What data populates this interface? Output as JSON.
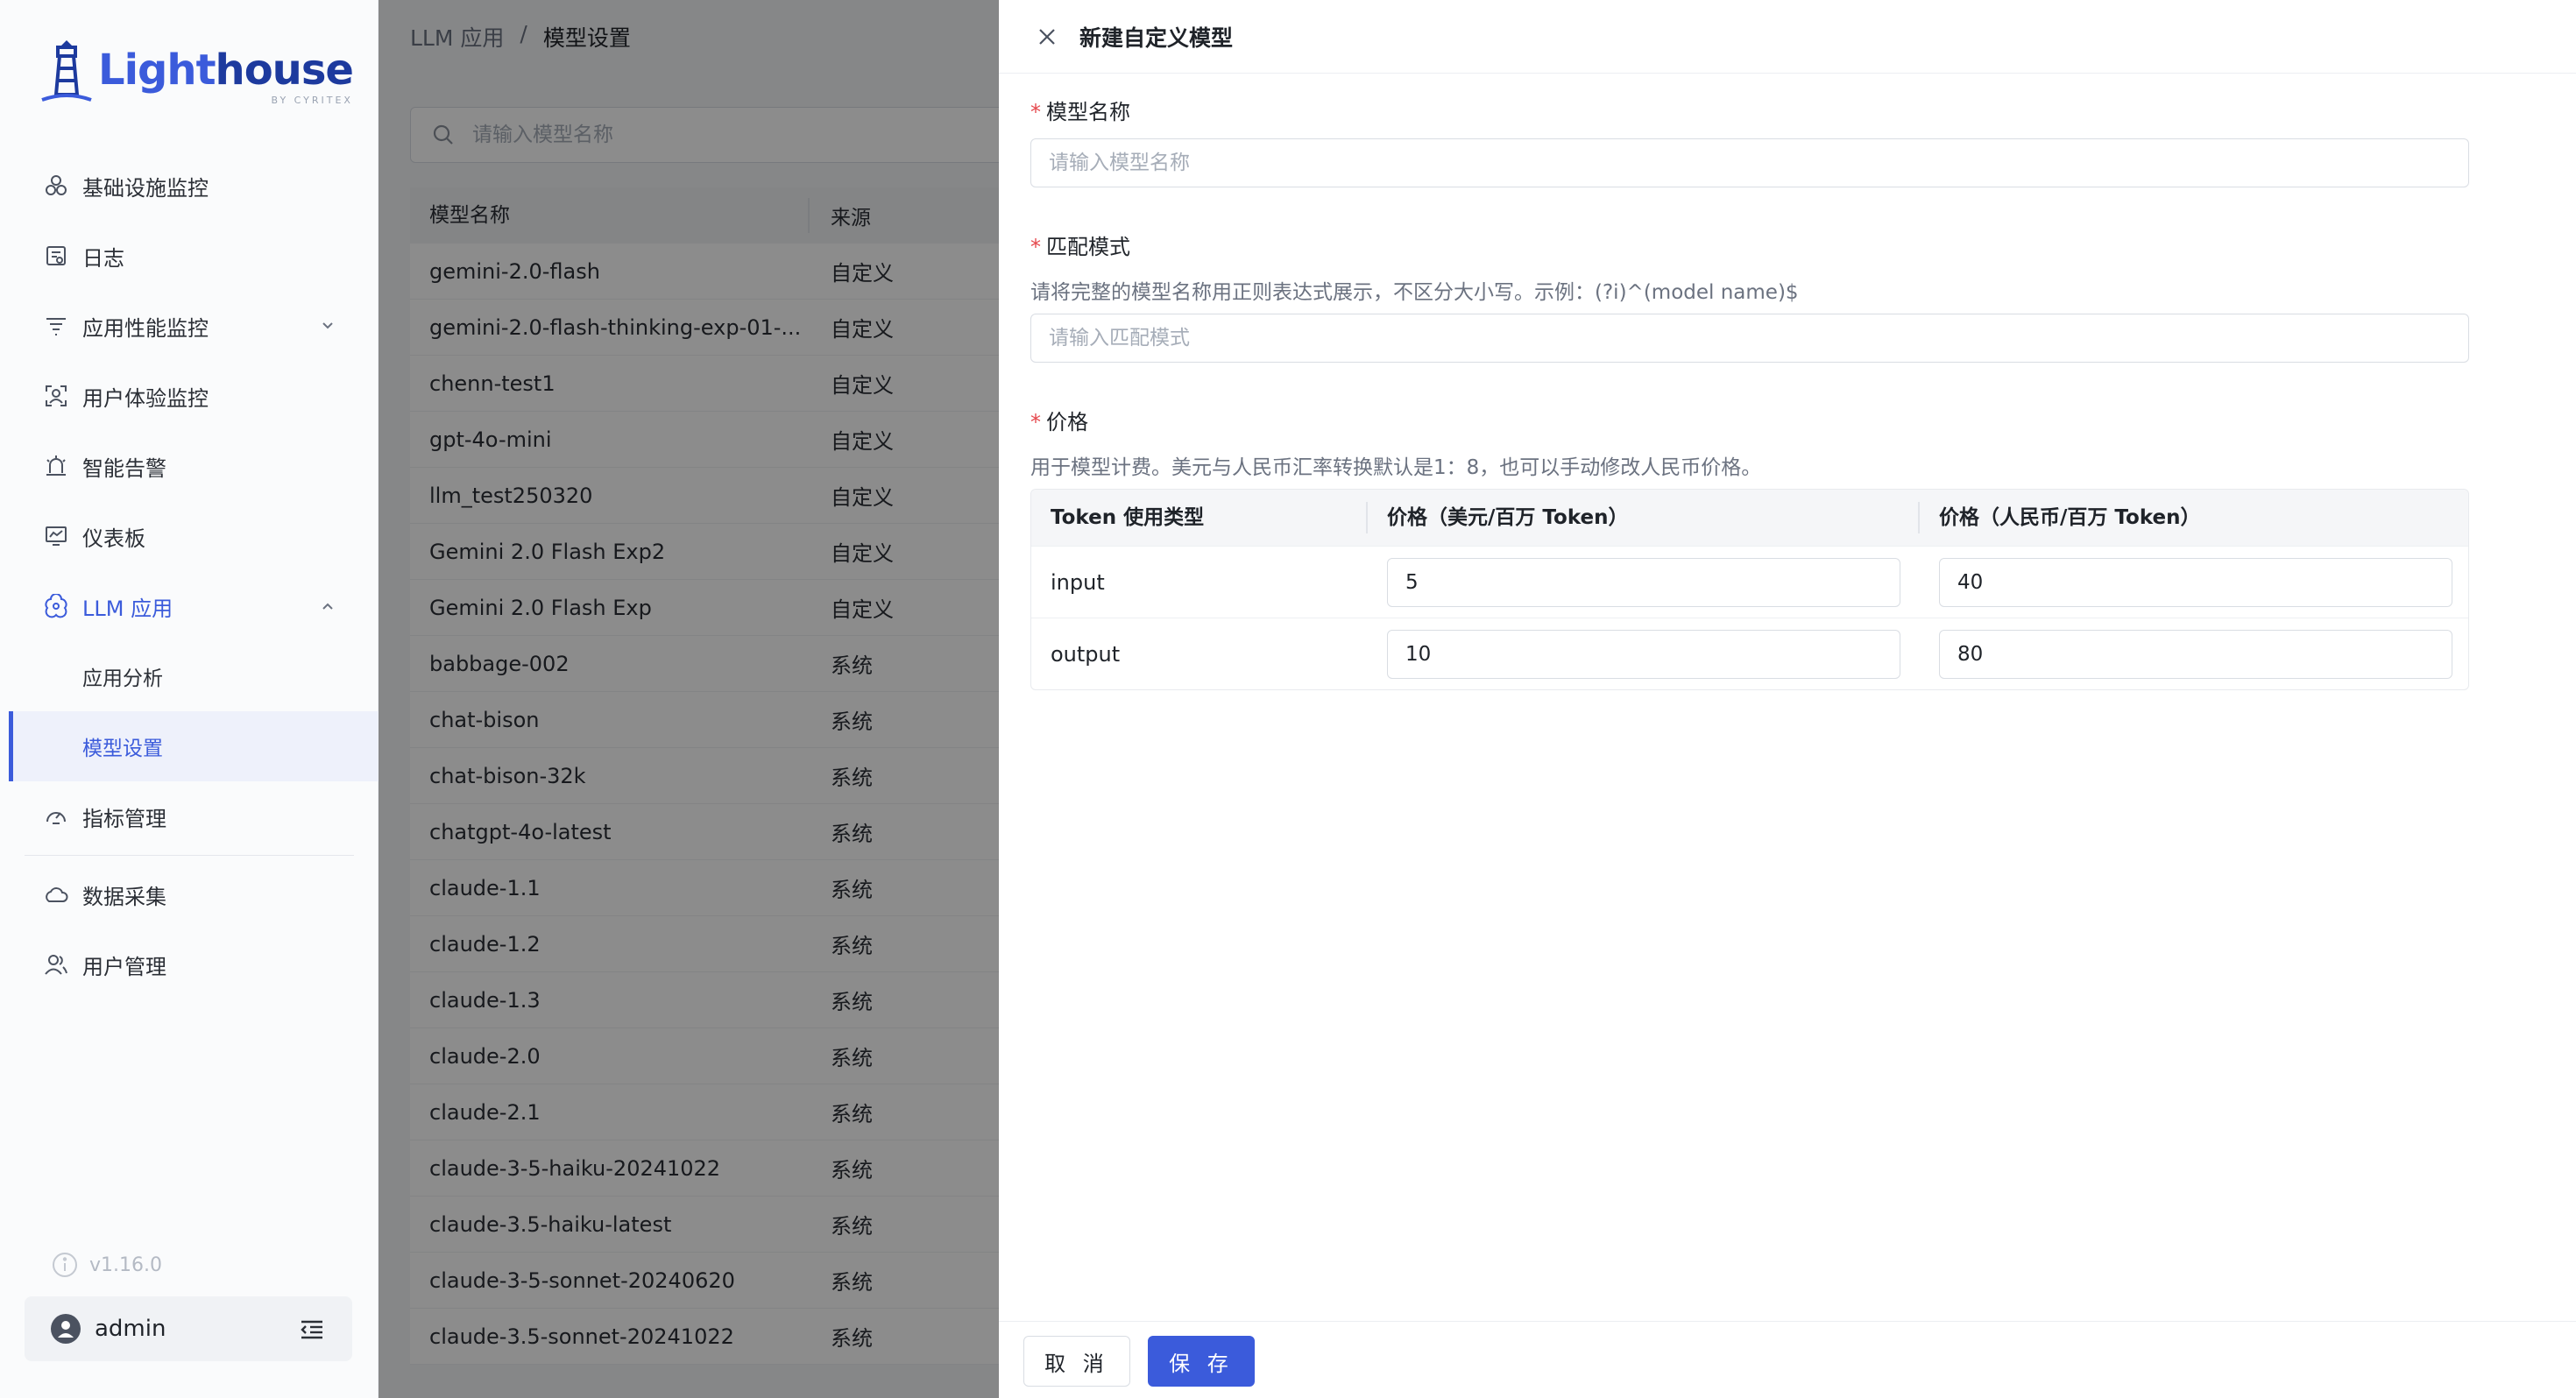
{
  "logo": {
    "part1": "Light",
    "part2": "house",
    "sub": "BY CYRITEX"
  },
  "sidebar": {
    "items": [
      {
        "label": "基础设施监控",
        "icon": "infrastructure-icon"
      },
      {
        "label": "日志",
        "icon": "log-icon"
      },
      {
        "label": "应用性能监控",
        "icon": "apm-icon"
      },
      {
        "label": "用户体验监控",
        "icon": "user-experience-icon"
      },
      {
        "label": "智能告警",
        "icon": "alarm-icon"
      },
      {
        "label": "仪表板",
        "icon": "dashboard-icon"
      },
      {
        "label": "LLM 应用",
        "icon": "llm-icon"
      }
    ],
    "llm_sub": [
      {
        "label": "应用分析"
      },
      {
        "label": "模型设置"
      }
    ],
    "bottom_items": [
      {
        "label": "指标管理",
        "icon": "metrics-icon"
      },
      {
        "label": "数据采集",
        "icon": "data-collection-icon"
      },
      {
        "label": "用户管理",
        "icon": "user-management-icon"
      }
    ],
    "version": "v1.16.0",
    "user": "admin"
  },
  "breadcrumb": {
    "parent": "LLM 应用",
    "separator": "/",
    "current": "模型设置"
  },
  "search": {
    "placeholder": "请输入模型名称"
  },
  "table": {
    "headers": [
      "模型名称",
      "来源"
    ],
    "rows": [
      [
        "gemini-2.0-flash",
        "自定义"
      ],
      [
        "gemini-2.0-flash-thinking-exp-01-...",
        "自定义"
      ],
      [
        "chenn-test1",
        "自定义"
      ],
      [
        "gpt-4o-mini",
        "自定义"
      ],
      [
        "llm_test250320",
        "自定义"
      ],
      [
        "Gemini 2.0 Flash Exp2",
        "自定义"
      ],
      [
        "Gemini 2.0 Flash Exp",
        "自定义"
      ],
      [
        "babbage-002",
        "系统"
      ],
      [
        "chat-bison",
        "系统"
      ],
      [
        "chat-bison-32k",
        "系统"
      ],
      [
        "chatgpt-4o-latest",
        "系统"
      ],
      [
        "claude-1.1",
        "系统"
      ],
      [
        "claude-1.2",
        "系统"
      ],
      [
        "claude-1.3",
        "系统"
      ],
      [
        "claude-2.0",
        "系统"
      ],
      [
        "claude-2.1",
        "系统"
      ],
      [
        "claude-3-5-haiku-20241022",
        "系统"
      ],
      [
        "claude-3.5-haiku-latest",
        "系统"
      ],
      [
        "claude-3-5-sonnet-20240620",
        "系统"
      ],
      [
        "claude-3.5-sonnet-20241022",
        "系统"
      ]
    ]
  },
  "drawer": {
    "title": "新建自定义模型",
    "required_mark": "*",
    "model_name": {
      "label": "模型名称",
      "placeholder": "请输入模型名称"
    },
    "match_pattern": {
      "label": "匹配模式",
      "hint": "请将完整的模型名称用正则表达式展示，不区分大小写。示例：(?i)^(model name)$",
      "placeholder": "请输入匹配模式"
    },
    "price": {
      "label": "价格",
      "hint": "用于模型计费。美元与人民币汇率转换默认是1：8，也可以手动修改人民币价格。",
      "headers": [
        "Token 使用类型",
        "价格（美元/百万 Token）",
        "价格（人民币/百万 Token）"
      ],
      "rows": [
        {
          "type": "input",
          "usd": "5",
          "cny": "40"
        },
        {
          "type": "output",
          "usd": "10",
          "cny": "80"
        }
      ]
    },
    "cancel_label": "取 消",
    "save_label": "保 存"
  },
  "colors": {
    "accent": "#3b5bdb",
    "required": "#e5484d"
  }
}
